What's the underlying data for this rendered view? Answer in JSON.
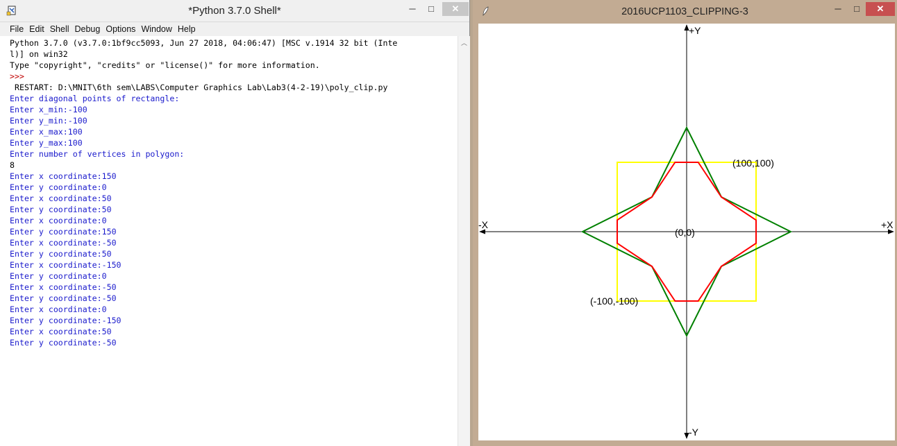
{
  "shell": {
    "title": "*Python 3.7.0 Shell*",
    "buttons": {
      "minimize": "─",
      "maximize": "□",
      "close": "✕"
    },
    "menu": [
      "File",
      "Edit",
      "Shell",
      "Debug",
      "Options",
      "Window",
      "Help"
    ],
    "lines": [
      {
        "text": "Python 3.7.0 (v3.7.0:1bf9cc5093, Jun 27 2018, 04:06:47) [MSC v.1914 32 bit (Inte",
        "style": "out"
      },
      {
        "text": "l)] on win32",
        "style": "out"
      },
      {
        "text": "Type \"copyright\", \"credits\" or \"license()\" for more information.",
        "style": "out"
      },
      {
        "text": ">>> ",
        "style": "prompt"
      },
      {
        "text": " RESTART: D:\\MNIT\\6th sem\\LABS\\Computer Graphics Lab\\Lab3(4-2-19)\\poly_clip.py",
        "style": "out"
      },
      {
        "text": "Enter diagonal points of rectangle:",
        "style": "blue"
      },
      {
        "text": "Enter x_min:-100",
        "style": "blue"
      },
      {
        "text": "Enter y_min:-100",
        "style": "blue"
      },
      {
        "text": "Enter x_max:100",
        "style": "blue"
      },
      {
        "text": "Enter y_max:100",
        "style": "blue"
      },
      {
        "text": "Enter number of vertices in polygon:",
        "style": "blue"
      },
      {
        "text": "8",
        "style": "out"
      },
      {
        "text": "Enter x coordinate:150",
        "style": "blue"
      },
      {
        "text": "Enter y coordinate:0",
        "style": "blue"
      },
      {
        "text": "Enter x coordinate:50",
        "style": "blue"
      },
      {
        "text": "Enter y coordinate:50",
        "style": "blue"
      },
      {
        "text": "Enter x coordinate:0",
        "style": "blue"
      },
      {
        "text": "Enter y coordinate:150",
        "style": "blue"
      },
      {
        "text": "Enter x coordinate:-50",
        "style": "blue"
      },
      {
        "text": "Enter y coordinate:50",
        "style": "blue"
      },
      {
        "text": "Enter x coordinate:-150",
        "style": "blue"
      },
      {
        "text": "Enter y coordinate:0",
        "style": "blue"
      },
      {
        "text": "Enter x coordinate:-50",
        "style": "blue"
      },
      {
        "text": "Enter y coordinate:-50",
        "style": "blue"
      },
      {
        "text": "Enter x coordinate:0",
        "style": "blue"
      },
      {
        "text": "Enter y coordinate:-150",
        "style": "blue"
      },
      {
        "text": "Enter x coordinate:50",
        "style": "blue"
      },
      {
        "text": "Enter y coordinate:-50",
        "style": "blue"
      }
    ]
  },
  "canvas_window": {
    "title": "2016UCP1103_CLIPPING-3",
    "buttons": {
      "minimize": "─",
      "maximize": "□",
      "close": "✕"
    },
    "labels": {
      "y_pos": "+Y",
      "y_neg": "-Y",
      "x_pos": "+X",
      "x_neg": "-X",
      "origin": "(0,0)",
      "max_corner": "(100,100)",
      "min_corner": "(-100,-100)"
    },
    "colors": {
      "axis": "#000000",
      "clip_rectangle": "#ffff00",
      "original_polygon": "#008000",
      "clipped_polygon": "#ff0000"
    },
    "clip_window": {
      "x_min": -100,
      "y_min": -100,
      "x_max": 100,
      "y_max": 100
    },
    "original_polygon": [
      [
        150,
        0
      ],
      [
        50,
        50
      ],
      [
        0,
        150
      ],
      [
        -50,
        50
      ],
      [
        -150,
        0
      ],
      [
        -50,
        -50
      ],
      [
        0,
        -150
      ],
      [
        50,
        -50
      ]
    ],
    "clipped_polygon": [
      [
        100,
        16.67
      ],
      [
        50,
        50
      ],
      [
        16.67,
        100
      ],
      [
        -16.67,
        100
      ],
      [
        -50,
        50
      ],
      [
        -100,
        16.67
      ],
      [
        -100,
        -16.67
      ],
      [
        -50,
        -50
      ],
      [
        -16.67,
        -100
      ],
      [
        16.67,
        -100
      ],
      [
        50,
        -50
      ],
      [
        100,
        -16.67
      ]
    ]
  }
}
